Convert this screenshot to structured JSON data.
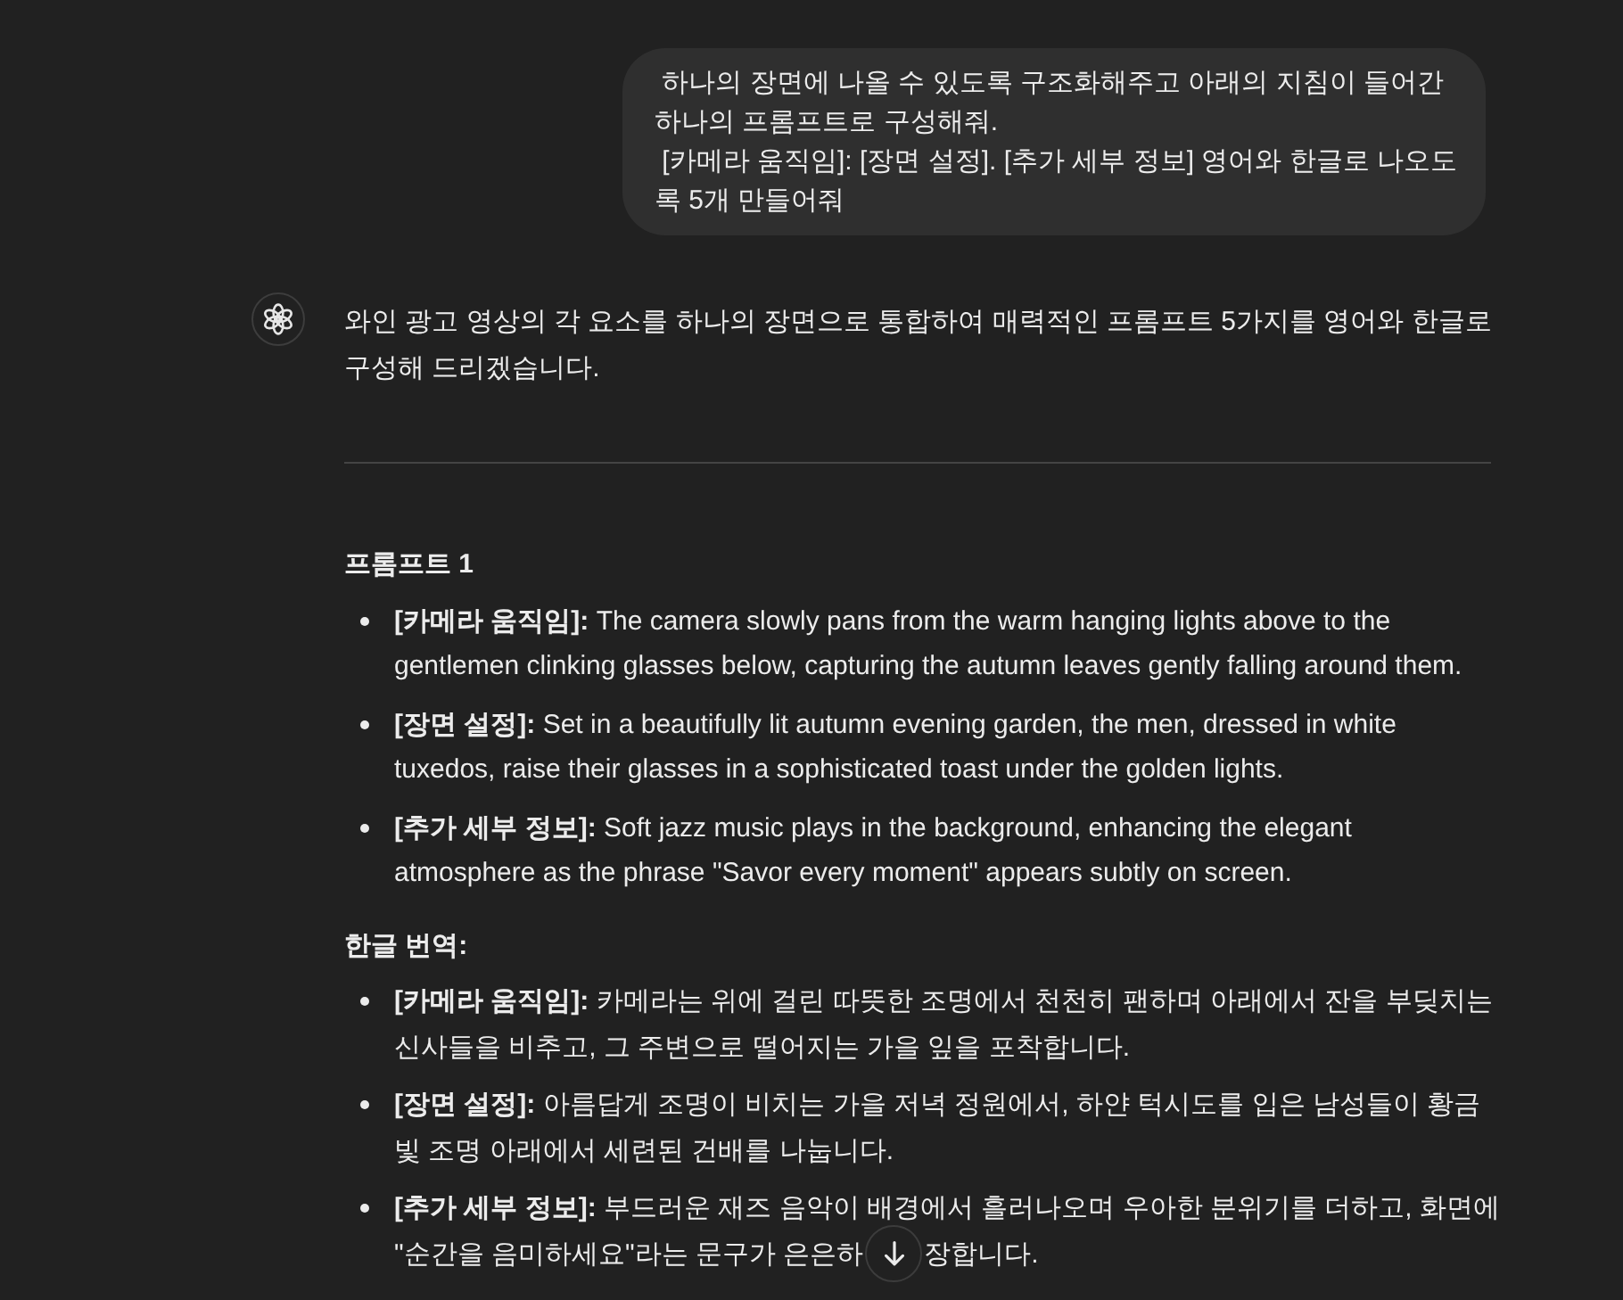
{
  "user_message": {
    "text": " 하나의 장면에 나올 수 있도록 구조화해주고 아래의 지침이 들어간 하나의 프롬프트로 구성해줘.\n [카메라 움직임]: [장면 설정]. [추가 세부 정보] 영어와 한글로 나오도록 5개 만들어줘"
  },
  "assistant_message": {
    "intro": "와인 광고 영상의 각 요소를 하나의 장면으로 통합하여 매력적인 프롬프트 5가지를 영어와 한글로 구성해 드리겠습니다.",
    "sections": [
      {
        "heading": "프롬프트 1",
        "items": [
          {
            "text": "**[카메라 움직임]:** The camera slowly pans from the warm hanging lights above to the gentlemen clinking glasses below, capturing the autumn leaves gently falling around them."
          },
          {
            "text": "**[장면 설정]:** Set in a beautifully lit autumn evening garden, the men, dressed in white tuxedos, raise their glasses in a sophisticated toast under the golden lights."
          },
          {
            "text": "**[추가 세부 정보]:** Soft jazz music plays in the background, enhancing the elegant atmosphere as the phrase \"Savor every moment\" appears subtly on screen."
          }
        ]
      },
      {
        "heading": "한글 번역:",
        "items": [
          {
            "text": "**[카메라 움직임]:** 카메라는 위에 걸린 따뜻한 조명에서 천천히 팬하며 아래에서 잔을 부딪치는 신사들을 비추고, 그 주변으로 떨어지는 가을 잎을 포착합니다."
          },
          {
            "text": "**[장면 설정]:** 아름답게 조명이 비치는 가을 저녁 정원에서, 하얀 턱시도를 입은 남성들이 황금빛 조명 아래에서 세련된 건배를 나눕니다."
          },
          {
            "text": "**[추가 세부 정보]:** 부드러운 재즈 음악이 배경에서 흘러나오며 우아한 분위기를 더하고, 화면에",
            "covered_line": [
              "\"순간을 음미하세요\"라는 문구가 은은하",
              "장합니다."
            ]
          }
        ]
      }
    ]
  }
}
